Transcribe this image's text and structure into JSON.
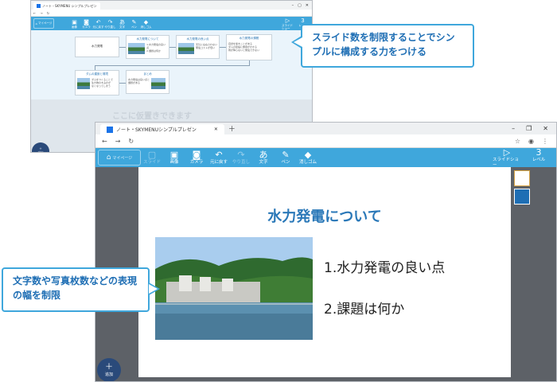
{
  "back_window": {
    "tab_title": "ノート・SKYMENU シンプルプレゼン",
    "toolbar": {
      "home_label": "マイページ",
      "tools": [
        {
          "icon": "image-icon",
          "glyph": "▣",
          "label": "画像"
        },
        {
          "icon": "camera-icon",
          "glyph": "◙",
          "label": "カメラ"
        },
        {
          "icon": "undo-icon",
          "glyph": "↶",
          "label": "元に戻す"
        },
        {
          "icon": "redo-icon",
          "glyph": "↷",
          "label": "やり直し"
        },
        {
          "icon": "text-icon",
          "glyph": "あ",
          "label": "文字"
        },
        {
          "icon": "pen-icon",
          "glyph": "✎",
          "label": "ペン"
        },
        {
          "icon": "eraser-icon",
          "glyph": "◆",
          "label": "消しゴム"
        }
      ],
      "slideshow_label": "スライドショー",
      "level_label": "レベル",
      "level_value": "3"
    },
    "slides": [
      {
        "title": "水力発電"
      },
      {
        "title": "水力発電について",
        "items": [
          "1.水力発電の良い点",
          "2.課題は何か"
        ]
      },
      {
        "title": "水力発電の良い点",
        "items": [
          "天気に左右されない",
          "発電コストが低い"
        ]
      },
      {
        "title": "水力発電の課題",
        "items": [
          "自然を壊すことがある",
          "ダムの建設に費用がかかる",
          "雨が降らないと発電できない"
        ]
      },
      {
        "title": "ダムの建設と環境",
        "items": [
          "ダムをつくることで",
          "生き物のすみかが",
          "なくなってしまう"
        ]
      },
      {
        "title": "まとめ",
        "items": [
          "水力発電は良い点と",
          "課題がある"
        ]
      }
    ],
    "drop_text": "ここに仮置きできます",
    "add_label": "追加"
  },
  "callouts": {
    "top": "スライド数を制限することでシンプルに構成する力をつける",
    "bottom": "文字数や写真枚数などの表現の幅を制限"
  },
  "front_window": {
    "tab_title": "ノート・SKYMENUシンプルプレゼン",
    "toolbar": {
      "home_label": "マイページ",
      "tools": [
        {
          "icon": "add-slide-icon",
          "glyph": "▢",
          "label": "スライド",
          "enabled": false
        },
        {
          "icon": "image-icon",
          "glyph": "▣",
          "label": "画像",
          "enabled": true
        },
        {
          "icon": "camera-icon",
          "glyph": "◙",
          "label": "カメラ",
          "enabled": true
        },
        {
          "icon": "undo-icon",
          "glyph": "↶",
          "label": "元に戻す",
          "enabled": true
        },
        {
          "icon": "redo-icon",
          "glyph": "↷",
          "label": "やり直し",
          "enabled": false
        },
        {
          "icon": "text-icon",
          "glyph": "あ",
          "label": "文字",
          "enabled": true
        },
        {
          "icon": "pen-icon",
          "glyph": "✎",
          "label": "ペン",
          "enabled": true
        },
        {
          "icon": "eraser-icon",
          "glyph": "◆",
          "label": "消しゴム",
          "enabled": true
        }
      ],
      "slideshow_label": "スライドショー",
      "level_label": "レベル",
      "level_value": "3"
    },
    "slide": {
      "title": "水力発電について",
      "items": [
        "1.水力発電の良い点",
        "2.課題は何か"
      ]
    },
    "add_label": "追加"
  }
}
